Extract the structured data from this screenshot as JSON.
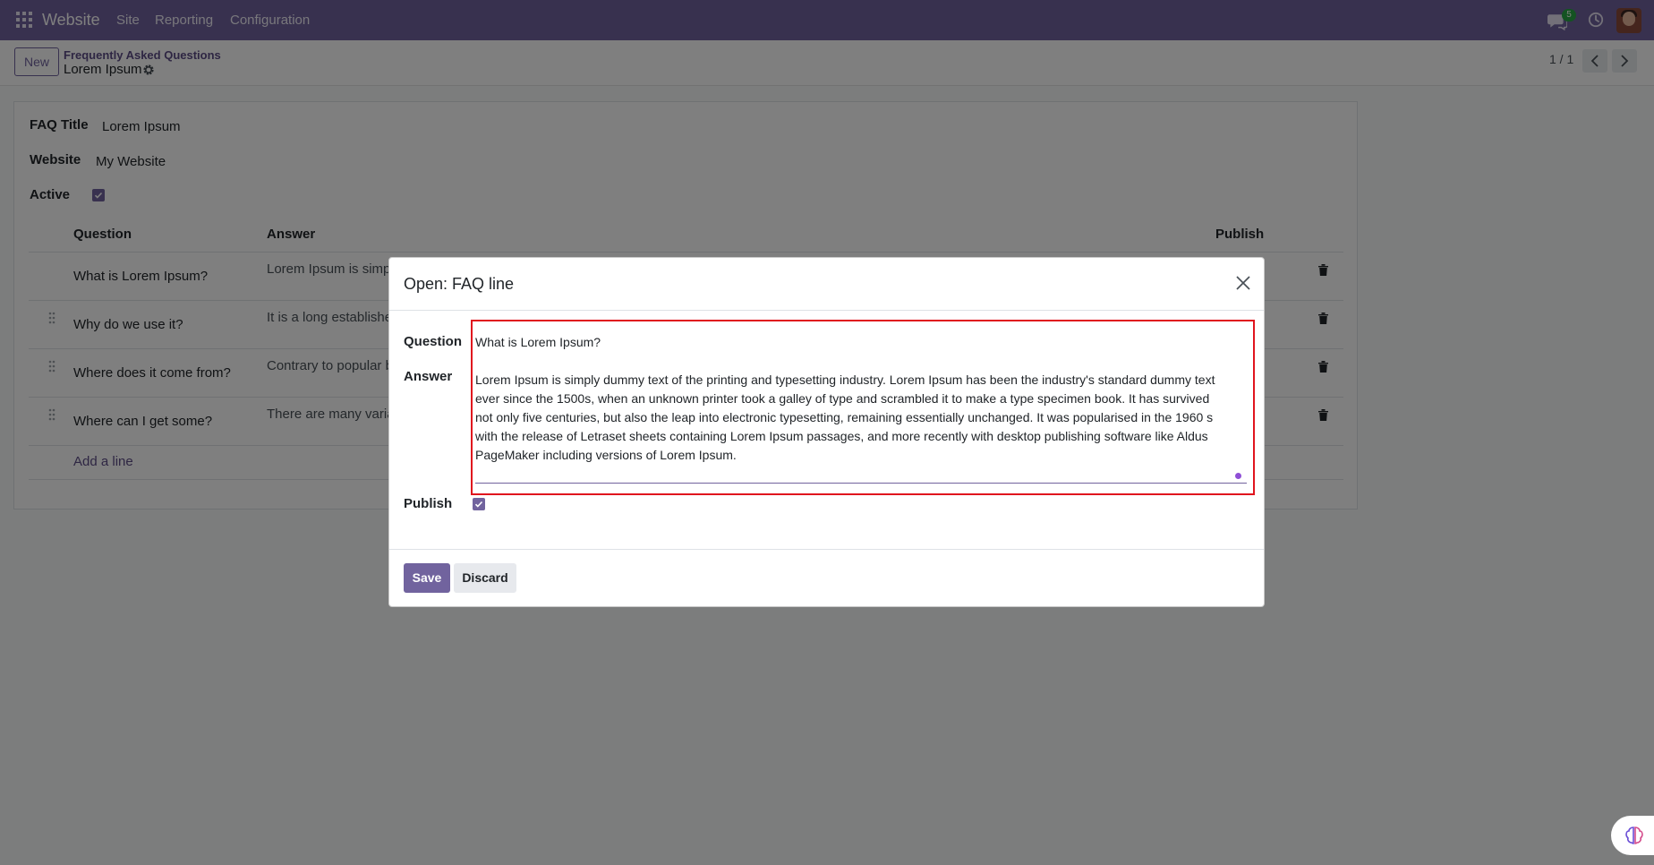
{
  "navbar": {
    "app_name": "Website",
    "menu": [
      "Site",
      "Reporting",
      "Configuration"
    ],
    "chat_count": "5"
  },
  "control": {
    "new_label": "New",
    "breadcrumb_parent": "Frequently Asked Questions",
    "breadcrumb_current": "Lorem Ipsum",
    "pager": "1 / 1"
  },
  "form": {
    "faq_title_label": "FAQ Title",
    "faq_title_value": "Lorem Ipsum",
    "website_label": "Website",
    "website_value": "My Website",
    "active_label": "Active",
    "active": true,
    "columns": [
      "Question",
      "Answer",
      "Publish"
    ],
    "rows": [
      {
        "question": "What is Lorem Ipsum?",
        "answer": "Lorem Ipsum is simply"
      },
      {
        "question": "Why do we use it?",
        "answer": "It is a long established"
      },
      {
        "question": "Where does it come from?",
        "answer": "Contrary to popular b"
      },
      {
        "question": "Where can I get some?",
        "answer": "There are many variat"
      }
    ],
    "add_line": "Add a line"
  },
  "modal": {
    "title": "Open: FAQ line",
    "question_label": "Question",
    "question_value": "What is Lorem Ipsum?",
    "answer_label": "Answer",
    "answer_value": "Lorem Ipsum is simply dummy text of the printing and typesetting industry. Lorem Ipsum has been the industry's standard dummy text ever since the 1500s, when an unknown printer took a galley of type and scrambled it to make a type specimen book. It has survived not only five centuries, but also the leap into electronic typesetting, remaining essentially unchanged. It was popularised in the 1960 s with the release of Letraset sheets containing Lorem Ipsum passages, and more recently with desktop publishing software like Aldus PageMaker including versions of Lorem Ipsum.",
    "publish_label": "Publish",
    "publish": true,
    "save_label": "Save",
    "discard_label": "Discard"
  },
  "colors": {
    "brand": "#71639e",
    "focus": "#e0141e"
  }
}
